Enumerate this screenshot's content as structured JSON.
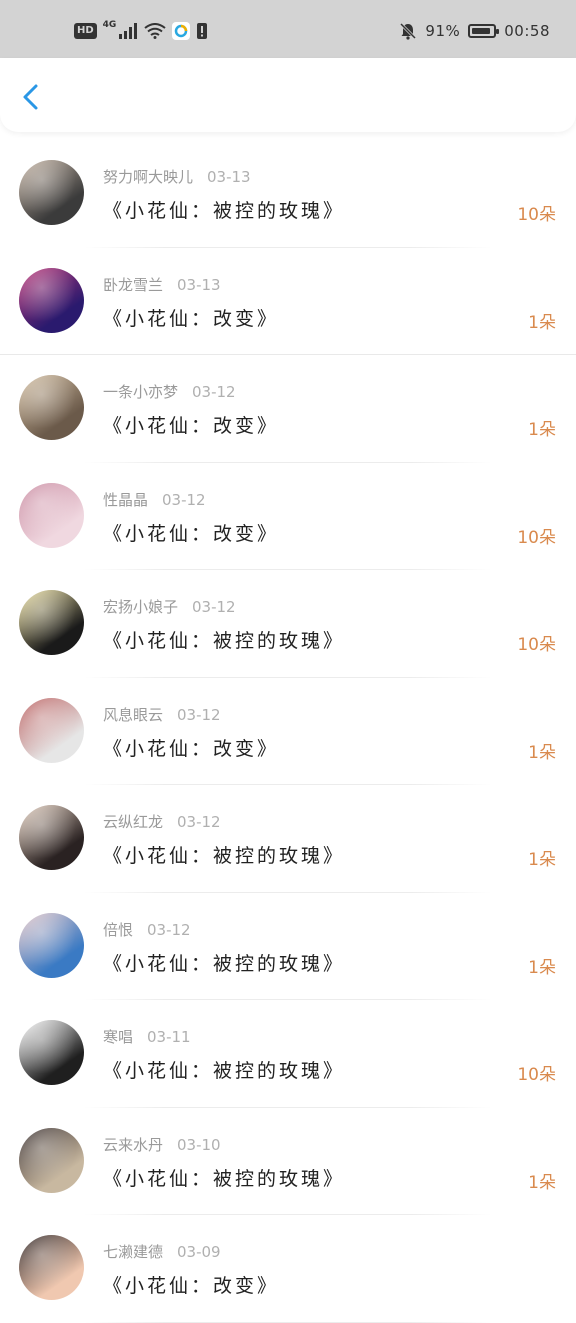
{
  "status_bar": {
    "hd": "HD",
    "network": "4G",
    "battery_percent": "91%",
    "time": "00:58",
    "battery_level": 0.91
  },
  "header": {
    "back_icon": "chevron-left-icon",
    "accent_color": "#2a97e6"
  },
  "list": [
    {
      "name": "努力啊大映儿",
      "date": "03-13",
      "gift": "《小花仙：被控的玫瑰》",
      "count": "10朵",
      "avatar_colors": [
        "#3b3b3b",
        "#c9b8a8"
      ]
    },
    {
      "name": "卧龙雪兰",
      "date": "03-13",
      "gift": "《小花仙：改变》",
      "count": "1朵",
      "avatar_colors": [
        "#2a1a6e",
        "#c23a7a"
      ]
    },
    {
      "name": "一条小亦梦",
      "date": "03-12",
      "gift": "《小花仙：改变》",
      "count": "1朵",
      "avatar_colors": [
        "#6b5a4a",
        "#d8c4a8"
      ]
    },
    {
      "name": "性晶晶",
      "date": "03-12",
      "gift": "《小花仙：改变》",
      "count": "10朵",
      "avatar_colors": [
        "#f0d8e0",
        "#c98aa0"
      ]
    },
    {
      "name": "宏扬小娘子",
      "date": "03-12",
      "gift": "《小花仙：被控的玫瑰》",
      "count": "10朵",
      "avatar_colors": [
        "#1a1a1a",
        "#f2e6a8"
      ]
    },
    {
      "name": "风息眼云",
      "date": "03-12",
      "gift": "《小花仙：改变》",
      "count": "1朵",
      "avatar_colors": [
        "#e6e6e6",
        "#b85a5a"
      ]
    },
    {
      "name": "云纵红龙",
      "date": "03-12",
      "gift": "《小花仙：被控的玫瑰》",
      "count": "1朵",
      "avatar_colors": [
        "#2a2222",
        "#e8d4c4"
      ]
    },
    {
      "name": "倍恨",
      "date": "03-12",
      "gift": "《小花仙：被控的玫瑰》",
      "count": "1朵",
      "avatar_colors": [
        "#3a7ac4",
        "#e8c8c8"
      ]
    },
    {
      "name": "寒唱",
      "date": "03-11",
      "gift": "《小花仙：被控的玫瑰》",
      "count": "10朵",
      "avatar_colors": [
        "#1f1f1f",
        "#ffffff"
      ]
    },
    {
      "name": "云来水丹",
      "date": "03-10",
      "gift": "《小花仙：被控的玫瑰》",
      "count": "1朵",
      "avatar_colors": [
        "#c8b8a0",
        "#3a3030"
      ]
    },
    {
      "name": "七濑建德",
      "date": "03-09",
      "gift": "《小花仙：改变》",
      "count": "",
      "avatar_colors": [
        "#f0c8b0",
        "#2a2020"
      ]
    }
  ]
}
